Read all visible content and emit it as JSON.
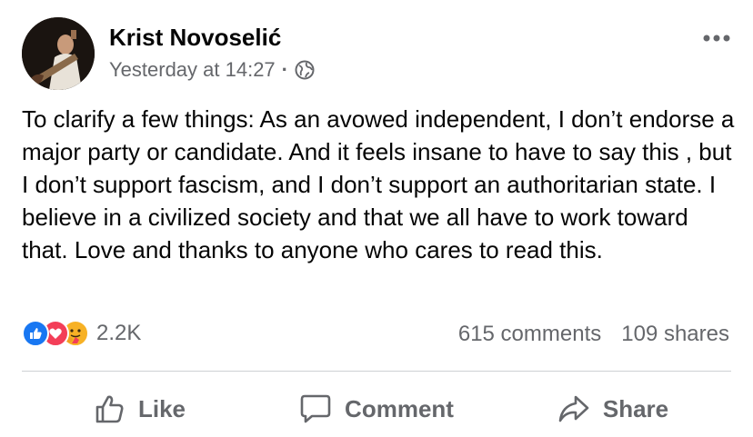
{
  "post": {
    "author": "Krist Novoselić",
    "timestamp": "Yesterday at 14:27",
    "separator": "·",
    "privacy_icon": "globe-icon",
    "more_icon": "more-options-icon",
    "text": "To clarify a few things: As an avowed independent, I don’t endorse a major party or candidate. And it feels insane to have to say this , but I don’t support fascism, and I don’t support an authoritarian state. I believe in a civilized society and that we all have to work toward that. Love and thanks to anyone who cares to read this."
  },
  "engagement": {
    "reaction_icons": [
      "like-reaction-icon",
      "love-reaction-icon",
      "care-reaction-icon"
    ],
    "reactions_count": "2.2K",
    "comments": "615 comments",
    "shares": "109 shares"
  },
  "actions": {
    "like_label": "Like",
    "comment_label": "Comment",
    "share_label": "Share"
  },
  "colors": {
    "like_blue": "#1877f2",
    "love_red": "#f33e58",
    "care_yellow": "#f7b125",
    "secondary_text": "#65676b"
  }
}
